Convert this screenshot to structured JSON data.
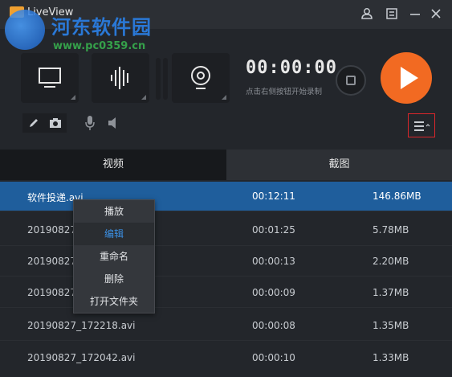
{
  "app": {
    "title": "LiveView"
  },
  "watermark": {
    "title": "河东软件园",
    "url": "www.pc0359.cn"
  },
  "toolbar": {
    "timer": "00:00:00",
    "hint": "点击右侧按钮开始录制"
  },
  "tabs": [
    {
      "label": "视频"
    },
    {
      "label": "截图"
    }
  ],
  "files": [
    {
      "name": "软件投递.avi",
      "duration": "00:12:11",
      "size": "146.86MB",
      "selected": true
    },
    {
      "name": "20190827",
      "duration": "00:01:25",
      "size": "5.78MB"
    },
    {
      "name": "20190827",
      "duration": "00:00:13",
      "size": "2.20MB"
    },
    {
      "name": "20190827",
      "duration": "00:00:09",
      "size": "1.37MB"
    },
    {
      "name": "20190827_172218.avi",
      "duration": "00:00:08",
      "size": "1.35MB"
    },
    {
      "name": "20190827_172042.avi",
      "duration": "00:00:10",
      "size": "1.33MB"
    }
  ],
  "context_menu": {
    "items": [
      {
        "label": "播放"
      },
      {
        "label": "编辑",
        "active": true
      },
      {
        "label": "重命名"
      },
      {
        "label": "删除"
      },
      {
        "label": "打开文件夹"
      }
    ]
  },
  "colors": {
    "accent": "#f26a22",
    "selection": "#1f5e9c",
    "highlight_text": "#3b8fe3",
    "alert_border": "#d9262b"
  }
}
